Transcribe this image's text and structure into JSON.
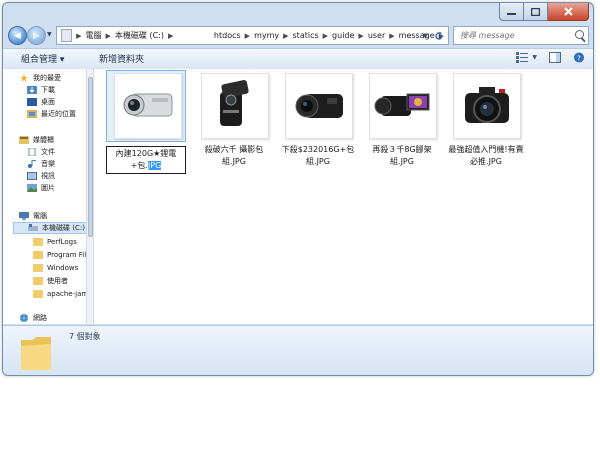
{
  "window": {
    "address": {
      "crumbs": [
        "電腦",
        "本機磁碟 (C:)",
        "htdocs",
        "mymy",
        "statics",
        "guide",
        "user",
        "message"
      ]
    },
    "search": {
      "placeholder": "搜尋 message"
    }
  },
  "toolbar": {
    "organize_label": "組合管理 ▾",
    "new_folder_label": "新增資料夾"
  },
  "nav": {
    "favorites": "我的最愛",
    "downloads": "下載",
    "desktop": "桌面",
    "recent": "最近的位置",
    "libraries": "媒體櫃",
    "documents": "文件",
    "music": "音樂",
    "videos": "視訊",
    "pictures": "圖片",
    "computer": "電腦",
    "local_disk": "本機磁碟 (C:)",
    "folders": [
      "PerfLogs",
      "Program Files",
      "Windows",
      "使用者",
      "apache-jame"
    ],
    "network": "網路"
  },
  "files": [
    {
      "name_before": "內建120G★鋰電+包.",
      "name_selected": "JPG",
      "thumb": "camcorder-silver"
    },
    {
      "name": "殺破六千 攝影包組.JPG",
      "thumb": "camcorder-black-flip"
    },
    {
      "name": "下殺$232016G+包組.JPG",
      "thumb": "camcorder-jvc"
    },
    {
      "name": "再殺３千8G腳架組.JPG",
      "thumb": "camcorder-sony-screen"
    },
    {
      "name": "最強超值入門機!有賣必推.JPG",
      "thumb": "dslr-canon"
    }
  ],
  "details": {
    "count": "7 個對象"
  },
  "colors": {
    "selection": "#3399ff",
    "frame": "#cfdff0"
  }
}
